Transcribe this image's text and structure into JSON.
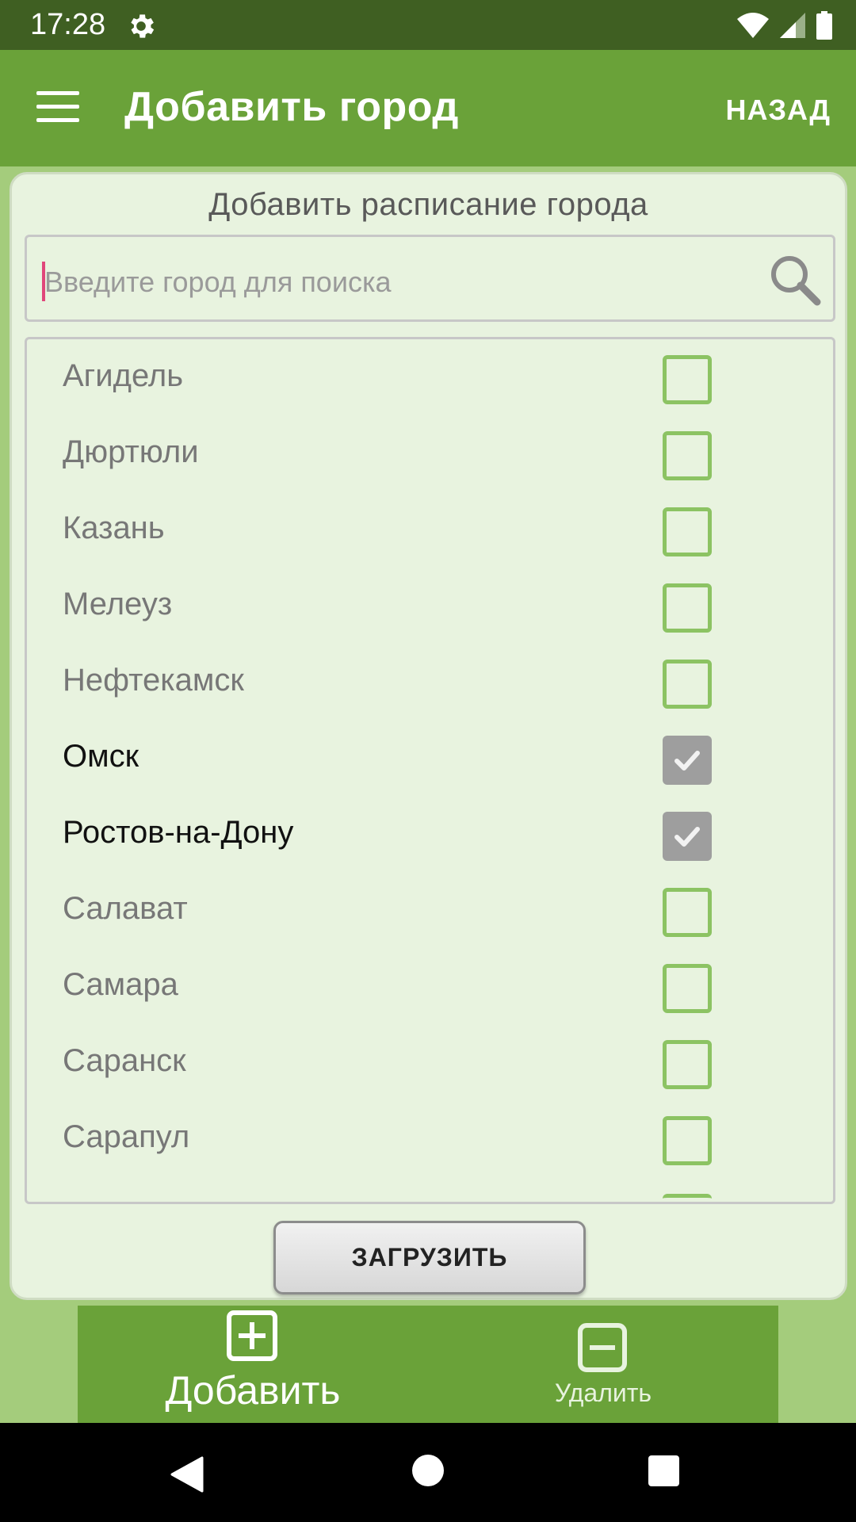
{
  "status_bar": {
    "time": "17:28",
    "icons": [
      "gear-icon",
      "wifi-icon",
      "signal-icon",
      "battery-icon"
    ]
  },
  "app_bar": {
    "title": "Добавить город",
    "back_label": "НАЗАД",
    "menu_icon": "hamburger-menu-icon"
  },
  "card": {
    "title": "Добавить расписание города",
    "search": {
      "placeholder": "Введите город для поиска",
      "value": ""
    },
    "cities": [
      {
        "name": "Агидель",
        "checked": false
      },
      {
        "name": "Дюртюли",
        "checked": false
      },
      {
        "name": "Казань",
        "checked": false
      },
      {
        "name": "Мелеуз",
        "checked": false
      },
      {
        "name": "Нефтекамск",
        "checked": false
      },
      {
        "name": "Омск",
        "checked": true
      },
      {
        "name": "Ростов-на-Дону",
        "checked": true
      },
      {
        "name": "Салават",
        "checked": false
      },
      {
        "name": "Самара",
        "checked": false
      },
      {
        "name": "Саранск",
        "checked": false
      },
      {
        "name": "Сарапул",
        "checked": false
      }
    ],
    "load_button": "ЗАГРУЗИТЬ"
  },
  "bottom_nav": {
    "add_label": "Добавить",
    "delete_label": "Удалить"
  },
  "colors": {
    "status_bar": "#3f5f22",
    "primary": "#6aa239",
    "background": "#a4cc7c",
    "card": "#e8f3df",
    "checkbox_border": "#8cc363",
    "checkbox_checked": "#9e9e9e",
    "caret": "#e0467a"
  }
}
